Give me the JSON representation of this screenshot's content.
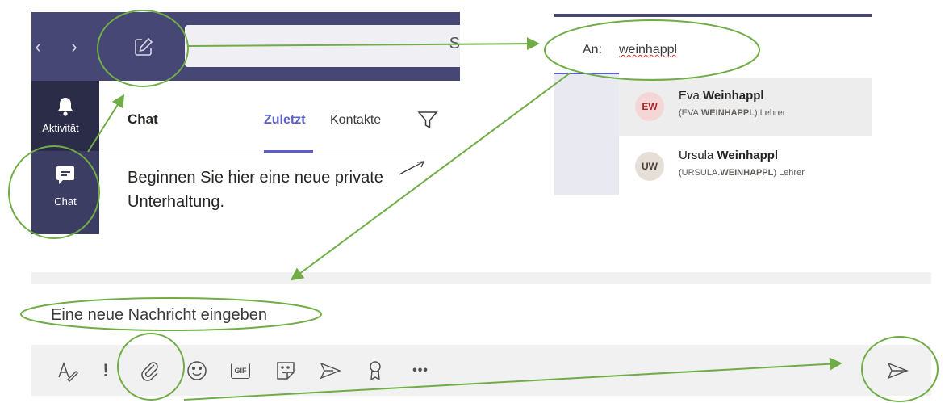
{
  "teams": {
    "nav_back": "‹",
    "nav_forward": "›",
    "compose_icon": "compose-icon",
    "search_hint": "S",
    "rail": {
      "activity_label": "Aktivität",
      "chat_label": "Chat"
    },
    "chat_header": {
      "title": "Chat",
      "tabs": [
        {
          "label": "Zuletzt",
          "active": true
        },
        {
          "label": "Kontakte",
          "active": false
        }
      ],
      "filter_icon": "filter-icon"
    },
    "hint_text": "Beginnen Sie hier eine neue private Unterhaltung."
  },
  "to_field": {
    "label": "An:",
    "value": "weinhappl",
    "suggestions": [
      {
        "initials": "EW",
        "first": "Eva",
        "last": "Weinhappl",
        "sub_prefix": "(EVA.",
        "sub_bold": "WEINHAPPL",
        "sub_suffix": ") Lehrer",
        "avatar_bg": "#f4d6d6",
        "avatar_fg": "#a4262c"
      },
      {
        "initials": "UW",
        "first": "Ursula",
        "last": "Weinhappl",
        "sub_prefix": "(URSULA.",
        "sub_bold": "WEINHAPPL",
        "sub_suffix": ") Lehrer",
        "avatar_bg": "#e6dfd8",
        "avatar_fg": "#4a3f35"
      }
    ]
  },
  "composer": {
    "placeholder": "Eine neue Nachricht eingeben",
    "tools": [
      "format-icon",
      "important-icon",
      "attach-icon",
      "emoji-icon",
      "gif-icon",
      "sticker-icon",
      "meet-icon",
      "praise-icon",
      "more-icon"
    ],
    "gif_label": "GIF",
    "more_label": "•••",
    "send_icon": "send-icon"
  },
  "colors": {
    "teams_purple": "#464775",
    "accent": "#5b5fc7",
    "annotation_green": "#70ad47"
  }
}
